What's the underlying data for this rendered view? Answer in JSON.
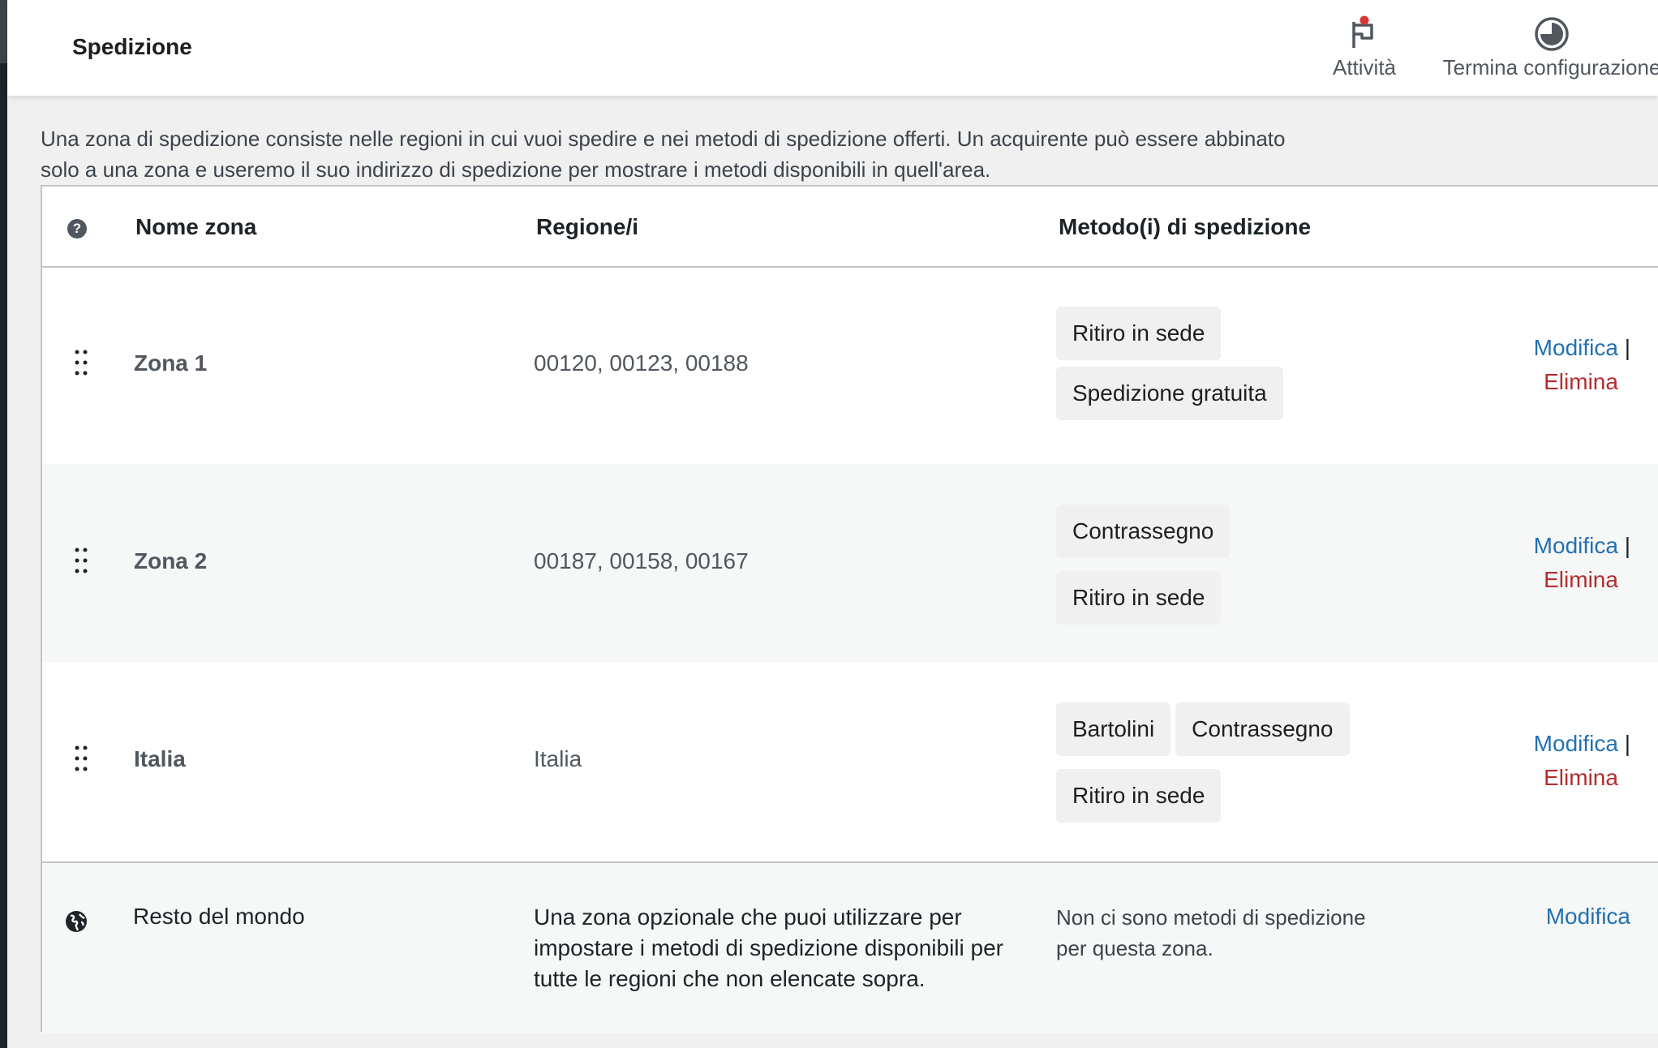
{
  "header": {
    "title": "Spedizione",
    "activity_label": "Attività",
    "finish_setup_label": "Termina configurazione"
  },
  "intro_text": "Una zona di spedizione consiste nelle regioni in cui vuoi spedire e nei metodi di spedizione offerti. Un acquirente può essere abbinato solo a una zona e useremo il suo indirizzo di spedizione per mostrare i metodi disponibili in quell'area.",
  "table": {
    "headers": {
      "help": "?",
      "zone_name": "Nome zona",
      "regions": "Regione/i",
      "methods": "Metodo(i) di spedizione"
    },
    "rows": [
      {
        "name": "Zona 1",
        "regions": "00120, 00123, 00188",
        "methods": [
          "Ritiro in sede",
          "Spedizione gratuita"
        ],
        "edit": "Modifica",
        "separator": "|",
        "delete": "Elimina"
      },
      {
        "name": "Zona 2",
        "regions": "00187, 00158, 00167",
        "methods": [
          "Contrassegno",
          "Ritiro in sede"
        ],
        "edit": "Modifica",
        "separator": "|",
        "delete": "Elimina"
      },
      {
        "name": "Italia",
        "regions": "Italia",
        "methods": [
          "Bartolini",
          "Contrassegno",
          "Ritiro in sede"
        ],
        "edit": "Modifica",
        "separator": "|",
        "delete": "Elimina"
      }
    ],
    "rest_of_world": {
      "name": "Resto del mondo",
      "description": "Una zona opzionale che puoi utilizzare per impostare i metodi di spedizione disponibili per tutte le regioni che non elencate sopra.",
      "no_methods": "Non ci sono metodi di spedizione per questa zona.",
      "edit": "Modifica"
    }
  },
  "colors": {
    "link": "#2271b1",
    "delete": "#b32d2e",
    "notification_dot": "#d63638"
  }
}
